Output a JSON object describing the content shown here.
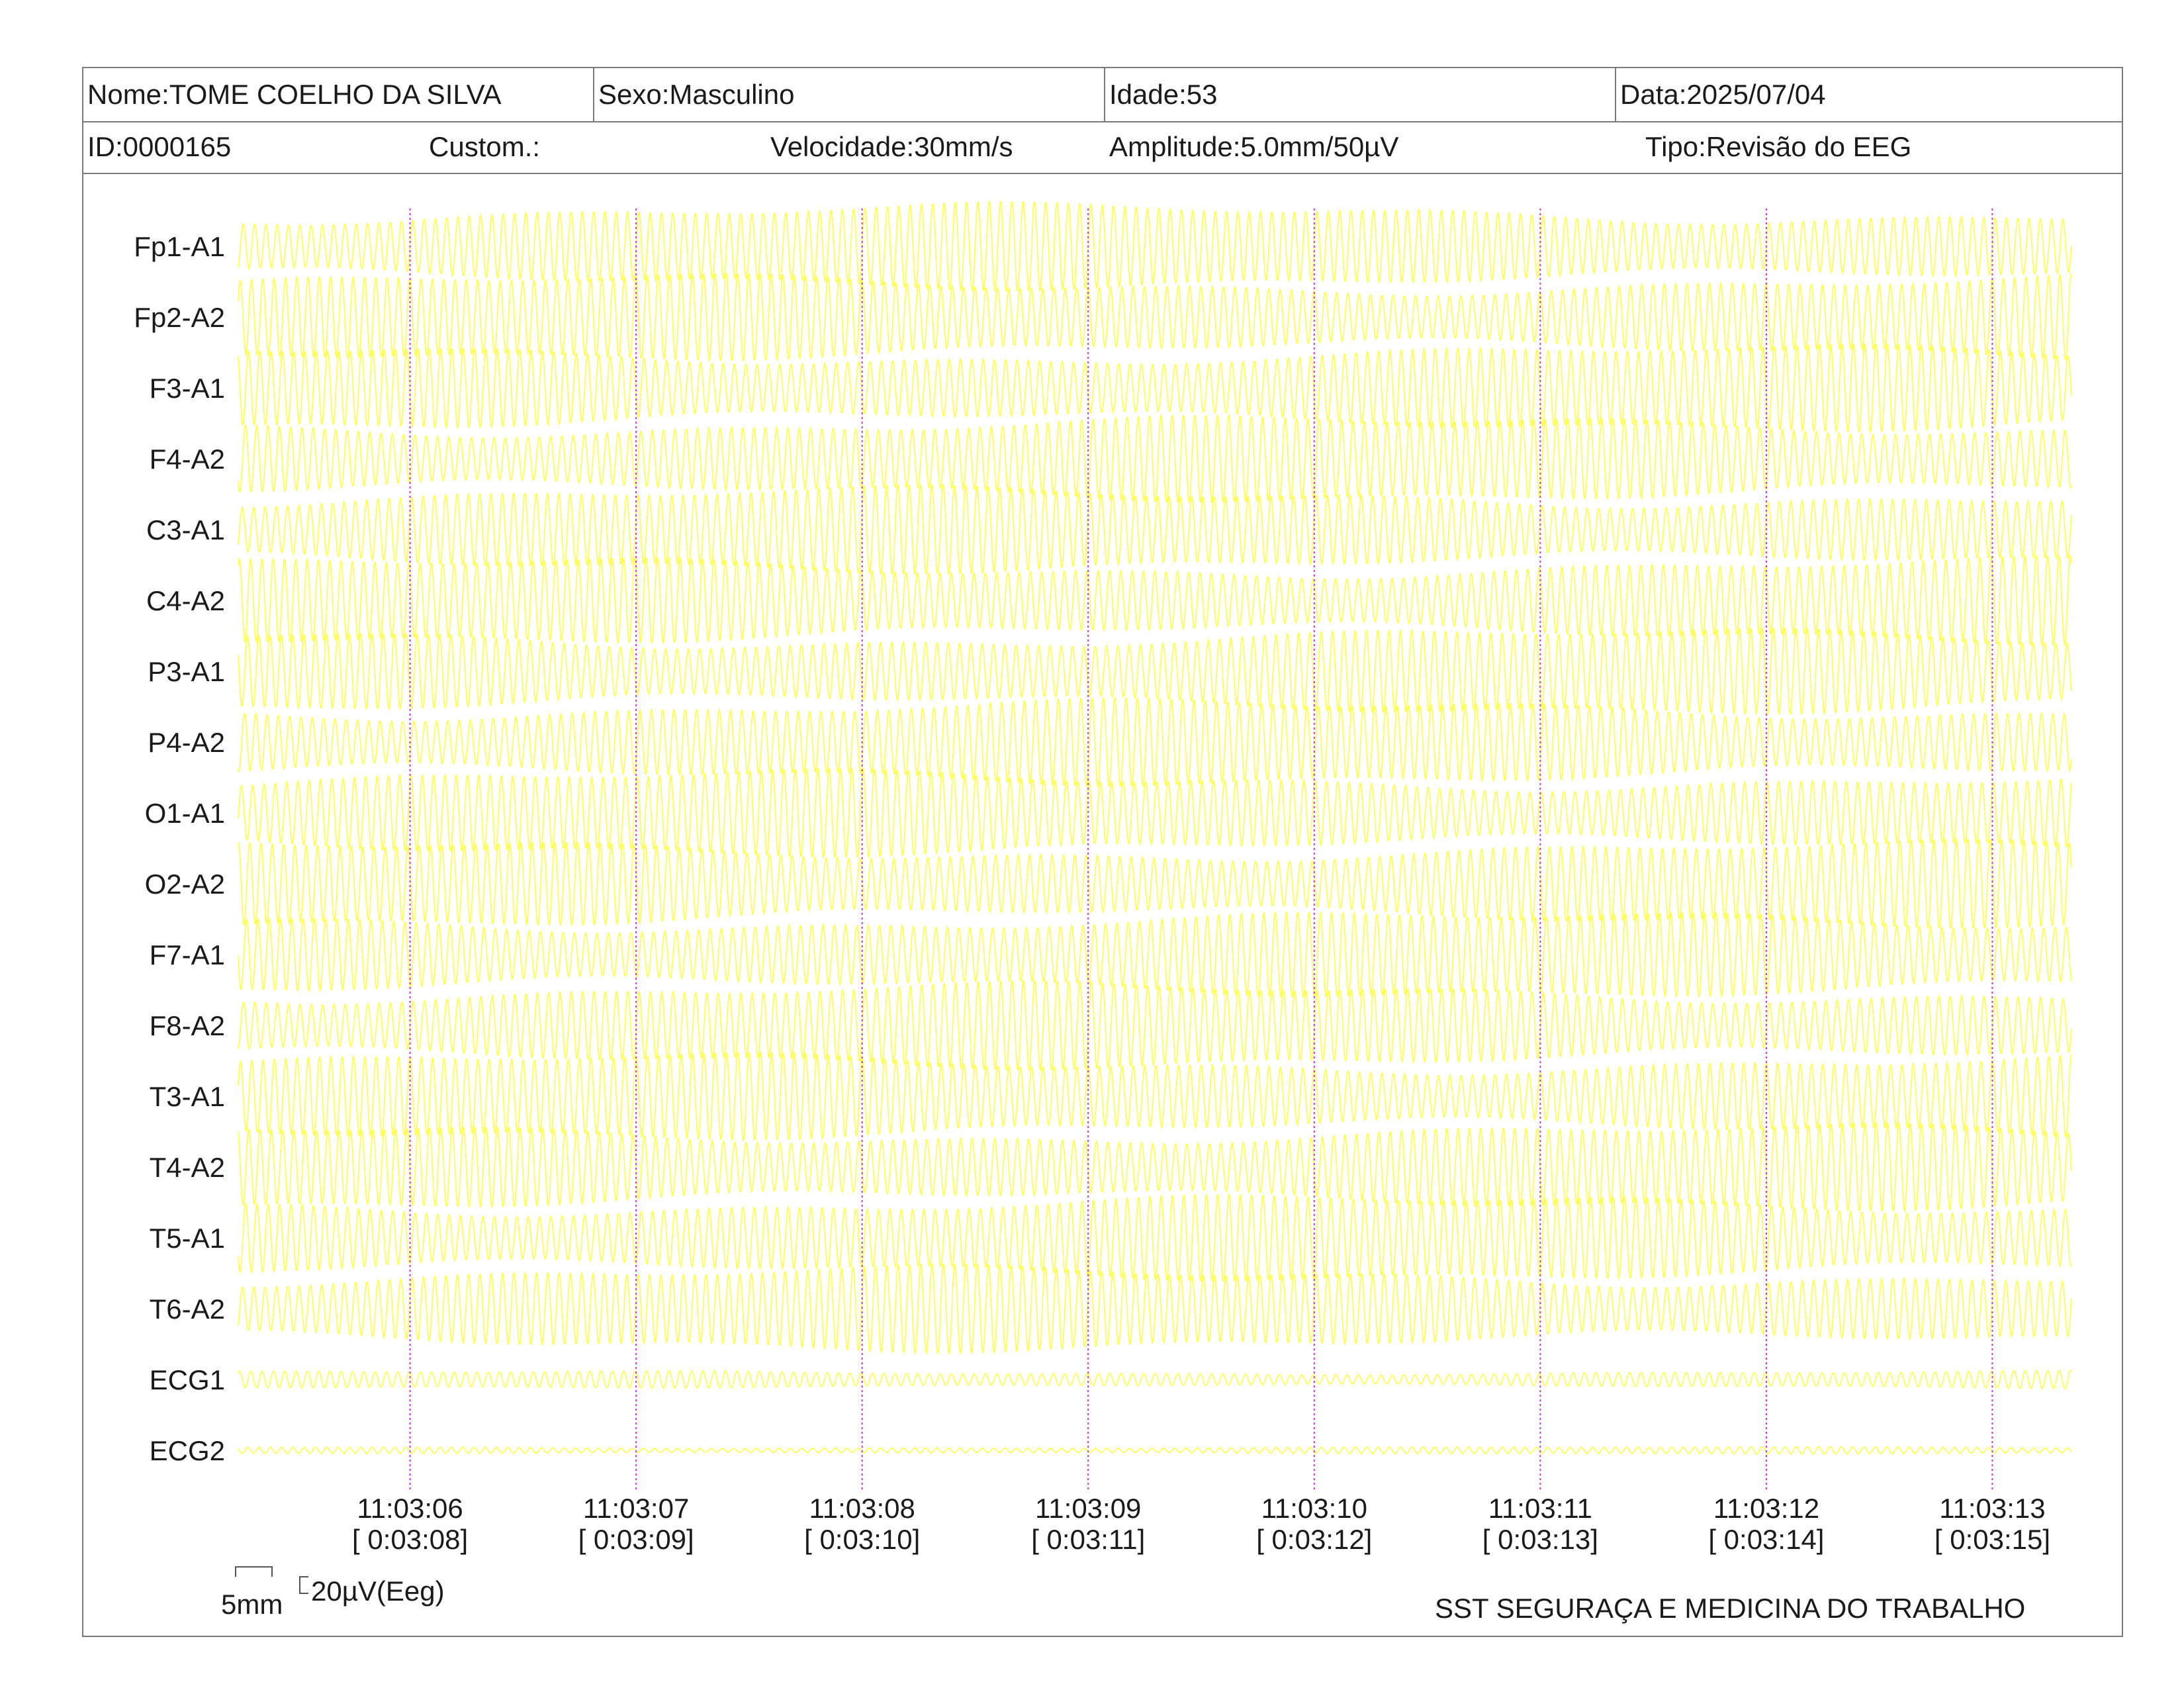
{
  "header": {
    "nome": "Nome:TOME COELHO DA SILVA",
    "sexo": "Sexo:Masculino",
    "idade": "Idade:53",
    "data": "Data:2025/07/04",
    "id": "ID:0000165",
    "custom": "Custom.:",
    "velocidade": "Velocidade:30mm/s",
    "amplitude": "Amplitude:5.0mm/50µV",
    "tipo": "Tipo:Revisão do EEG"
  },
  "scale": {
    "time_label": "5mm",
    "amp_label": "20µV(Eeg)"
  },
  "footer": {
    "institution": "SST SEGURAÇA E MEDICINA DO TRABALHO"
  },
  "colors": {
    "trace": "#ffff33",
    "marker": "#cc33cc",
    "border": "#7a7a7a",
    "text": "#1a1a1a"
  },
  "chart_data": {
    "type": "line",
    "title": "",
    "channels": [
      "Fp1-A1",
      "Fp2-A2",
      "F3-A1",
      "F4-A2",
      "C3-A1",
      "C4-A2",
      "P3-A1",
      "P4-A2",
      "O1-A1",
      "O2-A2",
      "F7-A1",
      "F8-A2",
      "T3-A1",
      "T4-A2",
      "T5-A1",
      "T6-A2",
      "ECG1",
      "ECG2"
    ],
    "time_ticks": [
      "11:03:06",
      "11:03:07",
      "11:03:08",
      "11:03:09",
      "11:03:10",
      "11:03:11",
      "11:03:12",
      "11:03:13"
    ],
    "elapsed_ticks": [
      "[ 0:03:08]",
      "[ 0:03:09]",
      "[ 0:03:10]",
      "[ 0:03:11]",
      "[ 0:03:12]",
      "[ 0:03:13]",
      "[ 0:03:14]",
      "[ 0:03:15]"
    ],
    "x_range_s": [
      5.24,
      13.35
    ],
    "marker_times_s": [
      6,
      7,
      8,
      9,
      10,
      11,
      12,
      13
    ],
    "waveform_frequency_hz": 20,
    "speed_mm_s": 30,
    "amplitude_mm_per_50uV": 5.0,
    "grid": false
  }
}
